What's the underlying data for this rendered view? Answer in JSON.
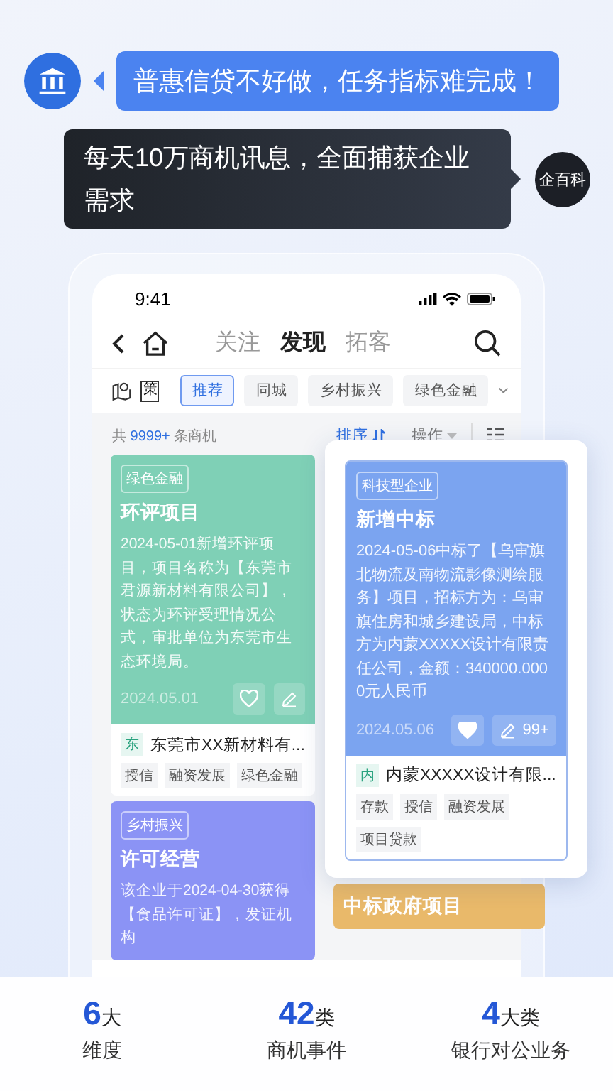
{
  "bubbles": [
    {
      "kind": "bank",
      "text": "普惠信贷不好做，任务指标难完成！"
    },
    {
      "kind": "app",
      "text": "每天10万商机讯息，全面捕获企业需求",
      "avatar": "企百科"
    }
  ],
  "phone": {
    "time": "9:41",
    "tabs": [
      {
        "label": "关注",
        "selected": false
      },
      {
        "label": "发现",
        "selected": true
      },
      {
        "label": "拓客",
        "selected": false
      }
    ],
    "policy_icon": "策",
    "filters": [
      {
        "label": "推荐",
        "selected": true
      },
      {
        "label": "同城",
        "selected": false
      },
      {
        "label": "乡村振兴",
        "selected": false
      },
      {
        "label": "绿色金融",
        "selected": false
      }
    ],
    "count": {
      "prefix": "共",
      "number": "9999+",
      "suffix": "条商机"
    },
    "sort": "排序",
    "action": "操作",
    "columns": [
      [
        {
          "color": "#7fd0b6",
          "popup": false,
          "tag": "绿色金融",
          "title": "环评项目",
          "body": "2024-05-01新增环评项目，项目名称为【东莞市君源新材料有限公司】，状态为环评受理情况公式，审批单位为东莞市生态环境局。",
          "date": "2024.05.01",
          "liked": false,
          "company_badge": "东",
          "company": "东莞市XX新材料有...",
          "tags": [
            "授信",
            "融资发展",
            "绿色金融"
          ]
        },
        {
          "color": "#8b93f5",
          "popup": false,
          "tag": "乡村振兴",
          "title": "许可经营",
          "body": "该企业于2024-04-30获得【食品许可证】，发证机构"
        }
      ],
      [
        {
          "color": "#7ba4f0",
          "popup": true,
          "tag": "科技型企业",
          "title": "新增中标",
          "body": "2024-05-06中标了【乌审旗北物流及南物流影像测绘服务】项目，招标方为：乌审旗住房和城乡建设局，中标方为内蒙XXXXX设计有限责任公司，金额：340000.0000元人民币",
          "date": "2024.05.06",
          "liked": true,
          "edit_count": "99+",
          "company_badge": "内",
          "company": "内蒙XXXXX设计有限...",
          "tags": [
            "存款",
            "授信",
            "融资发展",
            "项目贷款"
          ]
        },
        {
          "color": "#e9b96a",
          "popup": false,
          "title": "中标政府项目"
        }
      ]
    ]
  },
  "stats": [
    {
      "number": "6",
      "unit": "大",
      "label": "维度"
    },
    {
      "number": "42",
      "unit": "类",
      "label": "商机事件"
    },
    {
      "number": "4",
      "unit": "大类",
      "label": "银行对公业务"
    }
  ]
}
